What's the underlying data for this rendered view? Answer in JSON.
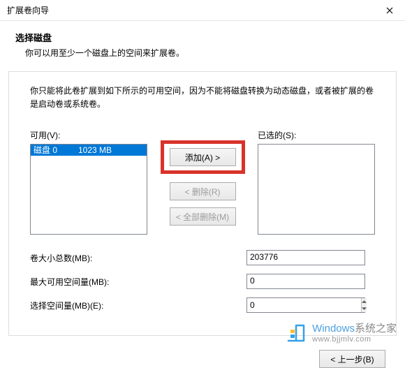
{
  "window": {
    "title": "扩展卷向导"
  },
  "header": {
    "title": "选择磁盘",
    "subtitle": "你可以用至少一个磁盘上的空间来扩展卷。"
  },
  "description": "你只能将此卷扩展到如下所示的可用空间，因为不能将磁盘转换为动态磁盘，或者被扩展的卷是启动卷或系统卷。",
  "lists": {
    "available_label": "可用(V):",
    "selected_label": "已选的(S):",
    "available_items": [
      {
        "disk": "磁盘 0",
        "size": "1023 MB"
      }
    ]
  },
  "buttons": {
    "add": "添加(A) >",
    "remove": "< 删除(R)",
    "remove_all": "< 全部删除(M)",
    "back": "< 上一步(B)"
  },
  "fields": {
    "total_label": "卷大小总数(MB):",
    "total_value": "203776",
    "max_label": "最大可用空间量(MB):",
    "max_value": "0",
    "select_label": "选择空间量(MB)(E):",
    "select_value": "0"
  },
  "watermark": {
    "brand": "Windows",
    "brand_suffix": "系统之家",
    "url": "www.bjjmlv.com"
  }
}
